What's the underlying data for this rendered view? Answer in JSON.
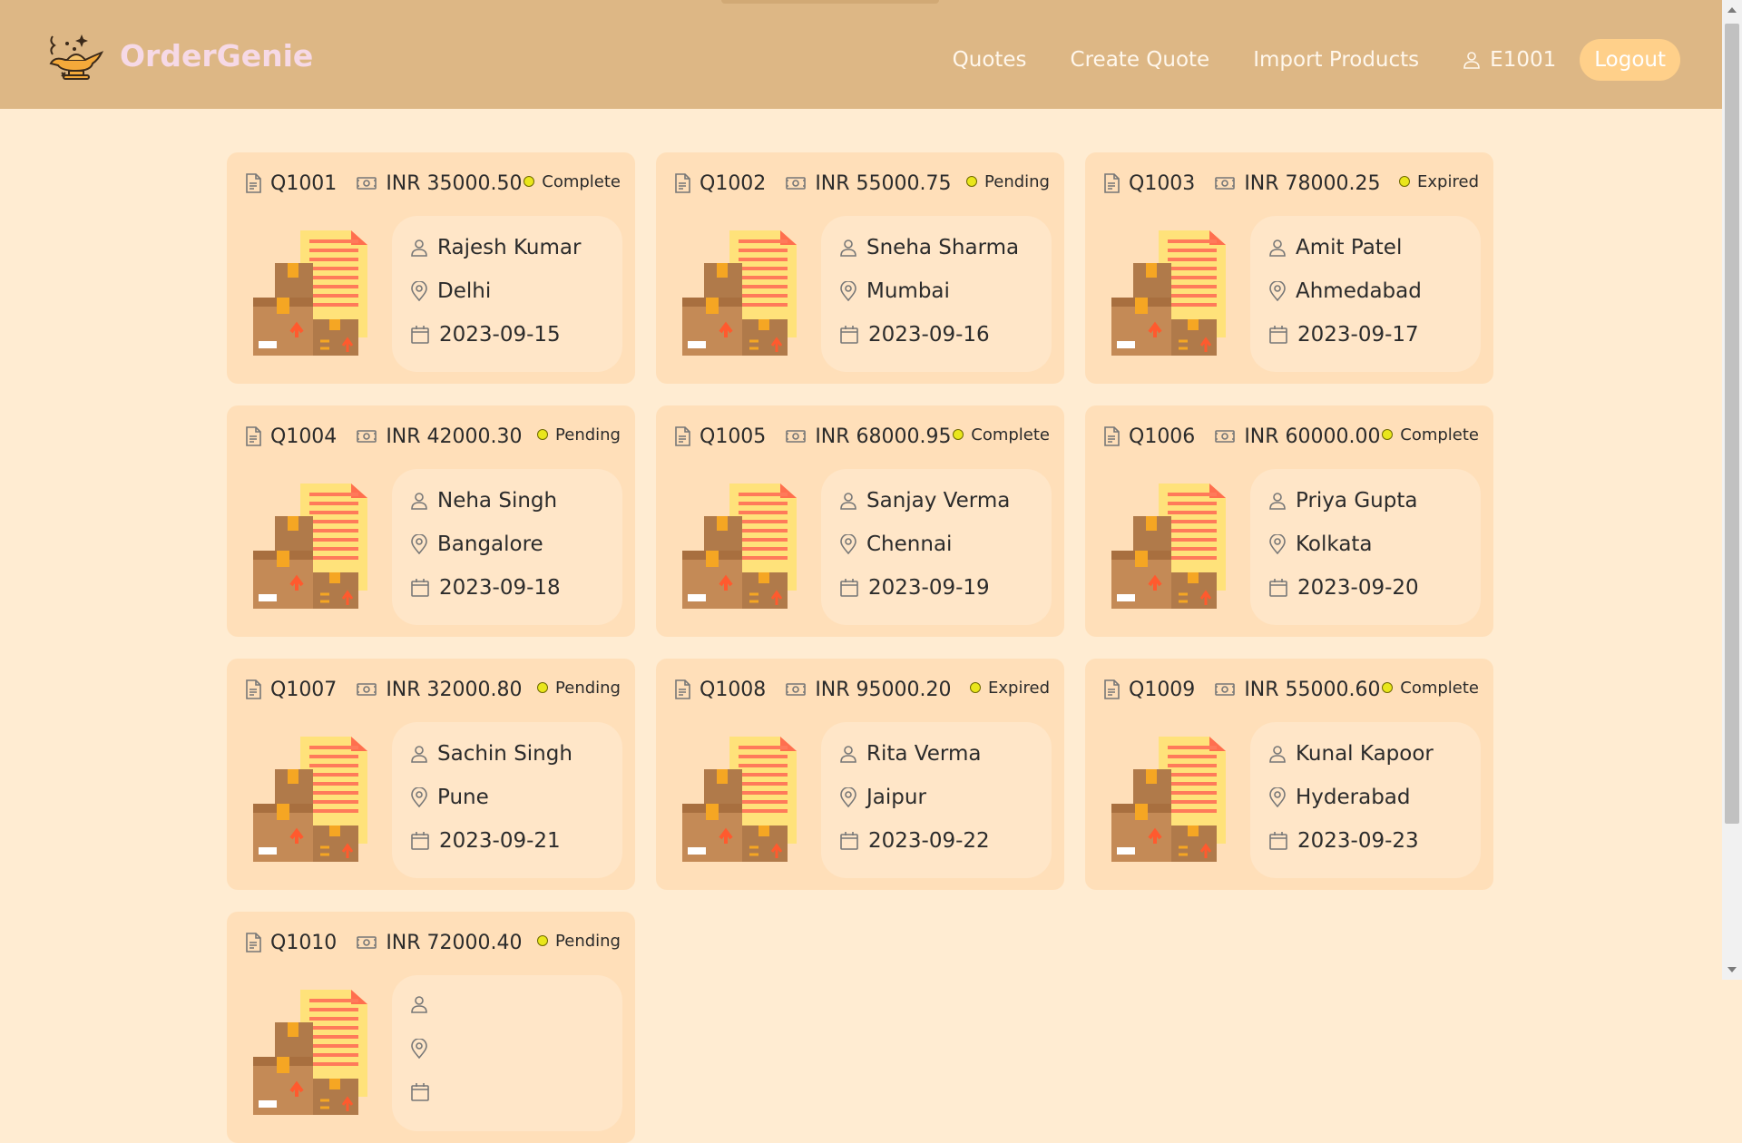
{
  "app": {
    "name": "OrderGenie"
  },
  "nav": {
    "links": [
      "Quotes",
      "Create Quote",
      "Import Products"
    ],
    "user_id": "E1001",
    "logout_label": "Logout"
  },
  "colors": {
    "header": "#ddb785",
    "background": "#ffecd2",
    "card": "#ffdfb9",
    "status_dot": "#e9e61b"
  },
  "icons": {
    "quote": "document-icon",
    "amount": "money-icon",
    "customer": "user-icon",
    "location": "map-pin-icon",
    "date": "calendar-icon",
    "status": "status-dot-icon"
  },
  "quotes": [
    {
      "id": "Q1001",
      "amount": "INR 35000.50",
      "status": "Complete",
      "customer": "Rajesh Kumar",
      "city": "Delhi",
      "date": "2023-09-15"
    },
    {
      "id": "Q1002",
      "amount": "INR 55000.75",
      "status": "Pending",
      "customer": "Sneha Sharma",
      "city": "Mumbai",
      "date": "2023-09-16"
    },
    {
      "id": "Q1003",
      "amount": "INR 78000.25",
      "status": "Expired",
      "customer": "Amit Patel",
      "city": "Ahmedabad",
      "date": "2023-09-17"
    },
    {
      "id": "Q1004",
      "amount": "INR 42000.30",
      "status": "Pending",
      "customer": "Neha Singh",
      "city": "Bangalore",
      "date": "2023-09-18"
    },
    {
      "id": "Q1005",
      "amount": "INR 68000.95",
      "status": "Complete",
      "customer": "Sanjay Verma",
      "city": "Chennai",
      "date": "2023-09-19"
    },
    {
      "id": "Q1006",
      "amount": "INR 60000.00",
      "status": "Complete",
      "customer": "Priya Gupta",
      "city": "Kolkata",
      "date": "2023-09-20"
    },
    {
      "id": "Q1007",
      "amount": "INR 32000.80",
      "status": "Pending",
      "customer": "Sachin Singh",
      "city": "Pune",
      "date": "2023-09-21"
    },
    {
      "id": "Q1008",
      "amount": "INR 95000.20",
      "status": "Expired",
      "customer": "Rita Verma",
      "city": "Jaipur",
      "date": "2023-09-22"
    },
    {
      "id": "Q1009",
      "amount": "INR 55000.60",
      "status": "Complete",
      "customer": "Kunal Kapoor",
      "city": "Hyderabad",
      "date": "2023-09-23"
    },
    {
      "id": "Q1010",
      "amount": "INR 72000.40",
      "status": "Pending",
      "customer": "",
      "city": "",
      "date": ""
    }
  ]
}
